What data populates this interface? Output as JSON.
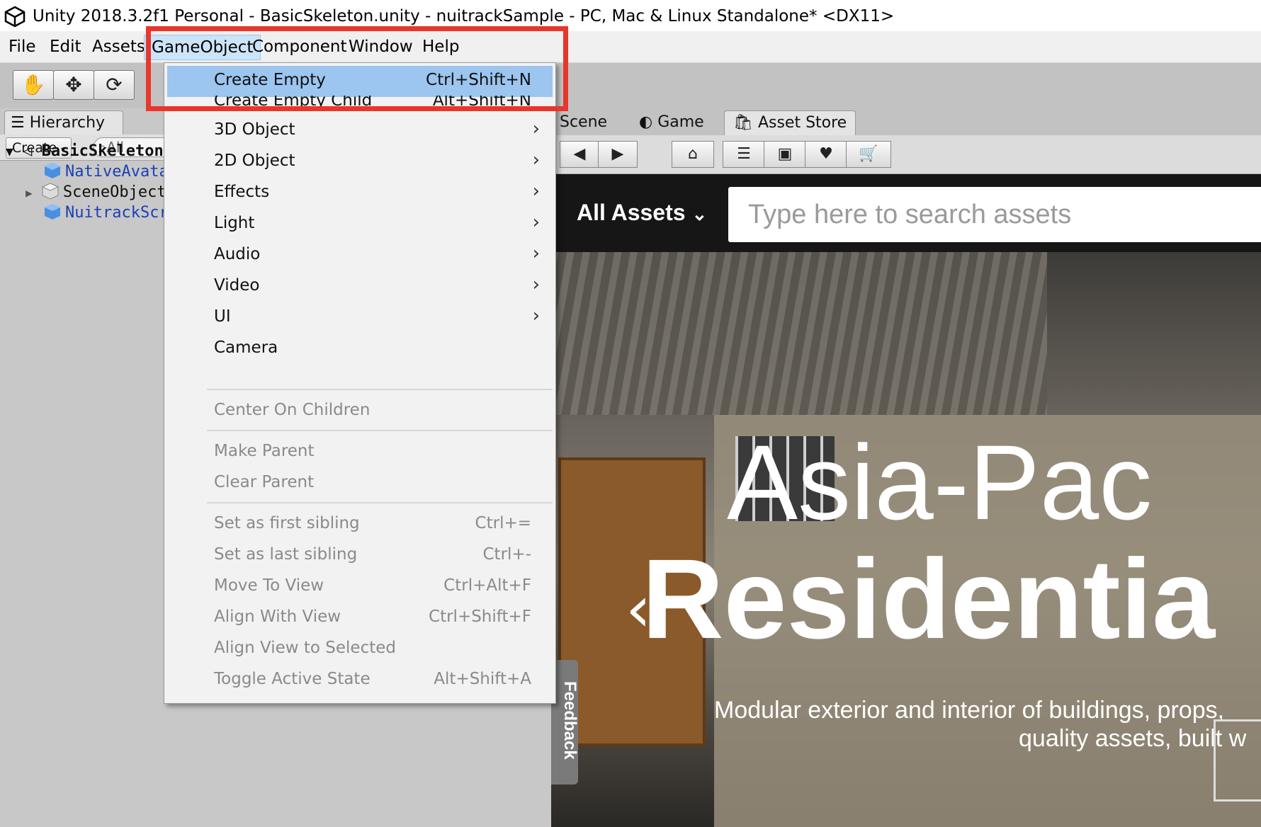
{
  "window": {
    "title": "Unity 2018.3.2f1 Personal - BasicSkeleton.unity - nuitrackSample - PC, Mac & Linux Standalone* <DX11>"
  },
  "menubar": {
    "items": [
      "File",
      "Edit",
      "Assets",
      "GameObject",
      "Component",
      "Window",
      "Help"
    ],
    "active": "GameObject"
  },
  "gameobject_menu": {
    "items": [
      {
        "label": "Create Empty",
        "shortcut": "Ctrl+Shift+N"
      },
      {
        "label": "Create Empty Child",
        "shortcut": "Alt+Shift+N"
      },
      {
        "label": "3D Object"
      },
      {
        "label": "2D Object"
      },
      {
        "label": "Effects"
      },
      {
        "label": "Light"
      },
      {
        "label": "Audio"
      },
      {
        "label": "Video"
      },
      {
        "label": "UI"
      },
      {
        "label": "Camera"
      },
      {
        "label": "Center On Children"
      },
      {
        "label": "Make Parent"
      },
      {
        "label": "Clear Parent"
      },
      {
        "label": "Set as first sibling",
        "shortcut": "Ctrl+="
      },
      {
        "label": "Set as last sibling",
        "shortcut": "Ctrl+-"
      },
      {
        "label": "Move To View",
        "shortcut": "Ctrl+Alt+F"
      },
      {
        "label": "Align With View",
        "shortcut": "Ctrl+Shift+F"
      },
      {
        "label": "Align View to Selected"
      },
      {
        "label": "Toggle Active State",
        "shortcut": "Alt+Shift+A"
      }
    ],
    "highlighted": "Create Empty"
  },
  "hierarchy": {
    "tab_label": "Hierarchy",
    "create_label": "Create",
    "search_placeholder": "All",
    "scene_name": "BasicSkeleton",
    "items": [
      "NativeAvatar",
      "SceneObjects",
      "NuitrackScripts"
    ]
  },
  "editor_tabs": [
    "Scene",
    "Game",
    "Asset Store"
  ],
  "asset_store": {
    "category": "All Assets",
    "search_placeholder": "Type here to search assets",
    "hero_title_line1": "Asia-Pac",
    "hero_title_line2": "Residentia",
    "hero_sub_line1": "Modular exterior and interior of buildings, props,",
    "hero_sub_line2": "quality assets, built w",
    "feedback_label": "Feedback"
  },
  "colors": {
    "highlight": "#9cc5ef",
    "callout": "#e8362b",
    "hierarchy_item_blue": "#1b3fb5"
  }
}
